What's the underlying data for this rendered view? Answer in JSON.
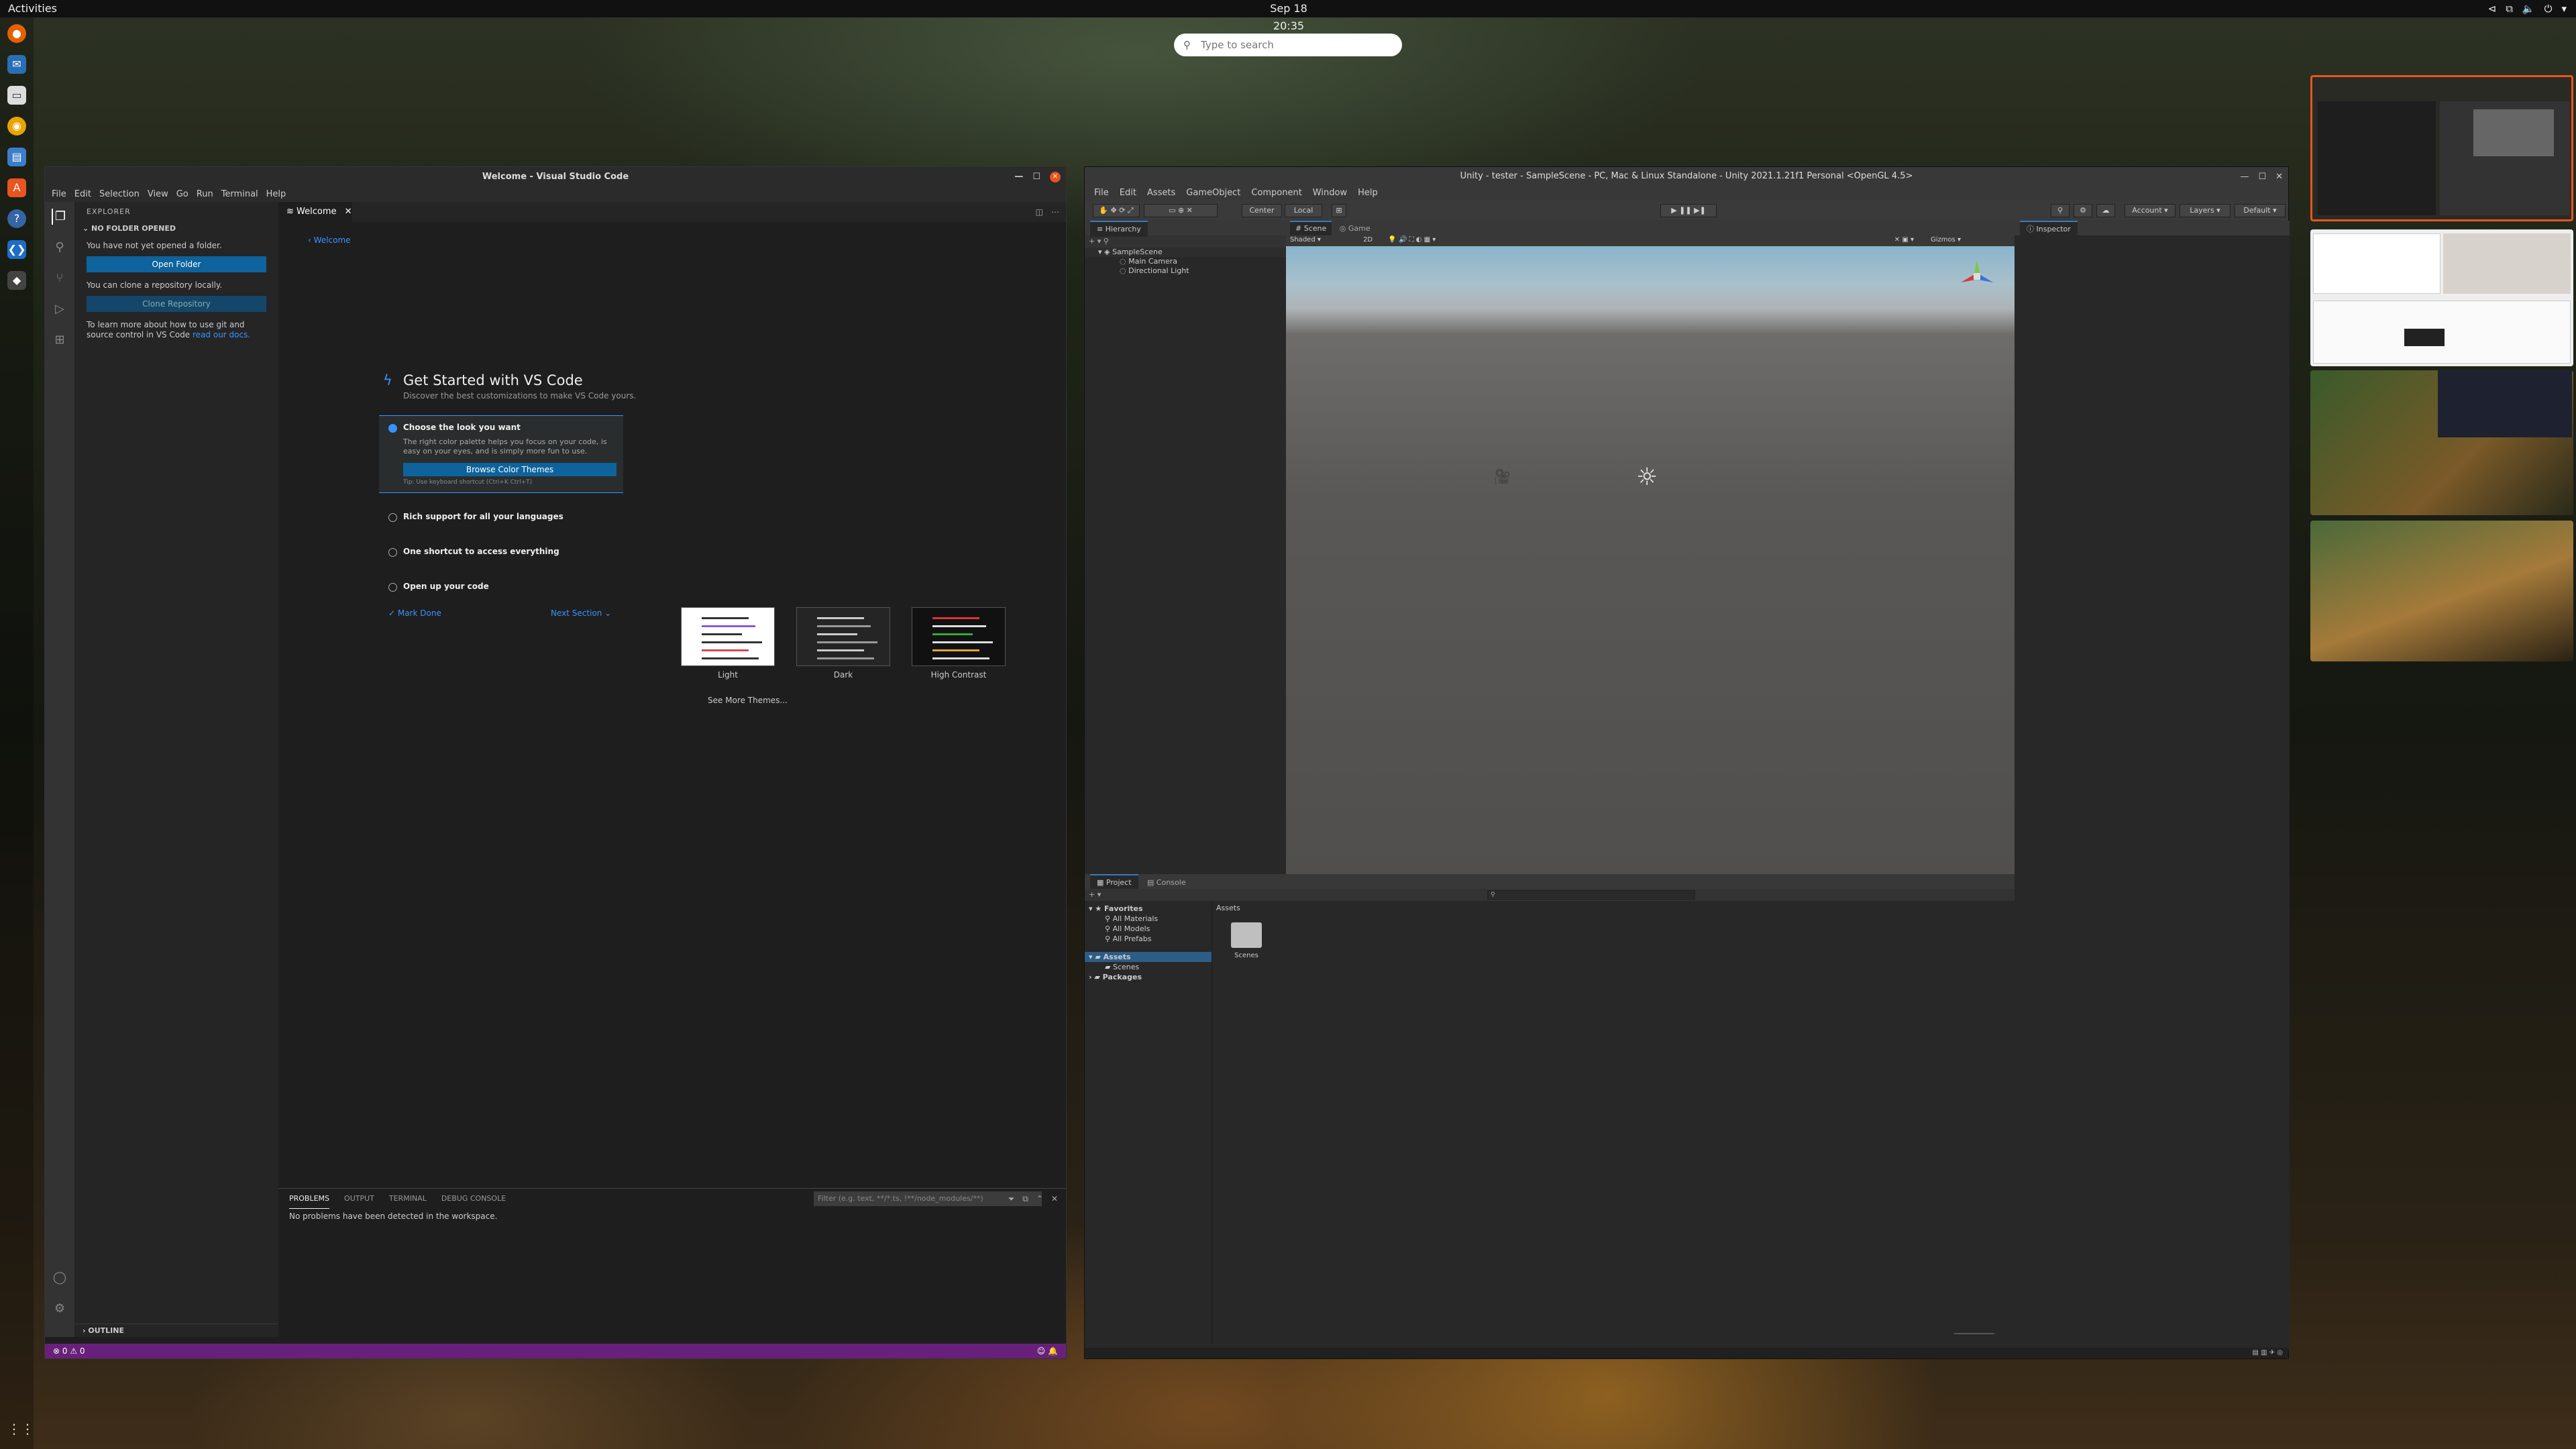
{
  "topbar": {
    "activities": "Activities",
    "clock": "Sep 18  20:35"
  },
  "search": {
    "placeholder": "Type to search"
  },
  "vscode": {
    "title": "Welcome - Visual Studio Code",
    "menu": [
      "File",
      "Edit",
      "Selection",
      "View",
      "Go",
      "Run",
      "Terminal",
      "Help"
    ],
    "explorer": {
      "header": "EXPLORER",
      "section": "NO FOLDER OPENED",
      "no_folder_text": "You have not yet opened a folder.",
      "open_folder": "Open Folder",
      "clone_text": "You can clone a repository locally.",
      "clone_repository": "Clone Repository",
      "learn_text": "To learn more about how to use git and source control in VS Code ",
      "learn_link": "read our docs.",
      "outline": "OUTLINE"
    },
    "tab": "Welcome",
    "breadcrumb": "Welcome",
    "getting_started": {
      "title": "Get Started with VS Code",
      "subtitle": "Discover the best customizations to make VS Code yours.",
      "step1_title": "Choose the look you want",
      "step1_desc": "The right color palette helps you focus on your code, is easy on your eyes, and is simply more fun to use.",
      "step1_button": "Browse Color Themes",
      "step1_tip": "Tip: Use keyboard shortcut (Ctrl+K Ctrl+T)",
      "step2": "Rich support for all your languages",
      "step3": "One shortcut to access everything",
      "step4": "Open up your code",
      "mark_done": "Mark Done",
      "next_section": "Next Section",
      "themes": [
        "Light",
        "Dark",
        "High Contrast"
      ],
      "see_more": "See More Themes..."
    },
    "panel": {
      "tabs": [
        "PROBLEMS",
        "OUTPUT",
        "TERMINAL",
        "DEBUG CONSOLE"
      ],
      "filter_placeholder": "Filter (e.g. text, **/*.ts, !**/node_modules/**)",
      "message": "No problems have been detected in the workspace."
    },
    "status": {
      "left": "⊗ 0 ⚠ 0"
    }
  },
  "unity": {
    "title": "Unity - tester - SampleScene - PC, Mac & Linux Standalone - Unity 2021.1.21f1 Personal <OpenGL 4.5>",
    "menu": [
      "File",
      "Edit",
      "Assets",
      "GameObject",
      "Component",
      "Window",
      "Help"
    ],
    "toolbar": {
      "center": "Center",
      "local": "Local",
      "account": "Account",
      "layers": "Layers",
      "layout": "Default"
    },
    "hierarchy": {
      "tab": "Hierarchy",
      "scene": "SampleScene",
      "items": [
        "Main Camera",
        "Directional Light"
      ]
    },
    "scene_tabs": [
      "Scene",
      "Game"
    ],
    "scene_bar": {
      "shading": "Shaded",
      "mode": "2D",
      "gizmos": "Gizmos"
    },
    "inspector": {
      "tab": "Inspector"
    },
    "project": {
      "tabs": [
        "Project",
        "Console"
      ],
      "favorites": "Favorites",
      "favorite_items": [
        "All Materials",
        "All Models",
        "All Prefabs"
      ],
      "assets": "Assets",
      "asset_children": [
        "Scenes"
      ],
      "packages": "Packages",
      "assets_header": "Assets",
      "folder_label": "Scenes"
    }
  }
}
